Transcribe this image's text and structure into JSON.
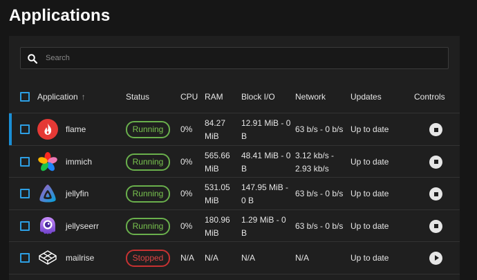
{
  "page_title": "Applications",
  "search": {
    "placeholder": "Search",
    "value": ""
  },
  "columns": {
    "application": "Application",
    "status": "Status",
    "cpu": "CPU",
    "ram": "RAM",
    "block_io": "Block I/O",
    "network": "Network",
    "updates": "Updates",
    "controls": "Controls"
  },
  "sort_indicator": "↑",
  "colors": {
    "accent": "#2d9fe4",
    "running": "#79c34f",
    "stopped": "#e04545",
    "row_highlight": "#1a8fd6"
  },
  "apps": [
    {
      "name": "flame",
      "icon": "flame-icon",
      "status": "Running",
      "cpu": "0%",
      "ram": "84.27 MiB",
      "block_io": "12.91 MiB - 0 B",
      "network": "63 b/s - 0 b/s",
      "updates": "Up to date",
      "control": "stop-icon"
    },
    {
      "name": "immich",
      "icon": "immich-icon",
      "status": "Running",
      "cpu": "0%",
      "ram": "565.66 MiB",
      "block_io": "48.41 MiB - 0 B",
      "network": "3.12 kb/s - 2.93 kb/s",
      "updates": "Up to date",
      "control": "stop-icon"
    },
    {
      "name": "jellyfin",
      "icon": "jellyfin-icon",
      "status": "Running",
      "cpu": "0%",
      "ram": "531.05 MiB",
      "block_io": "147.95 MiB - 0 B",
      "network": "63 b/s - 0 b/s",
      "updates": "Up to date",
      "control": "stop-icon"
    },
    {
      "name": "jellyseerr",
      "icon": "jellyseerr-icon",
      "status": "Running",
      "cpu": "0%",
      "ram": "180.96 MiB",
      "block_io": "1.29 MiB - 0 B",
      "network": "63 b/s - 0 b/s",
      "updates": "Up to date",
      "control": "stop-icon"
    },
    {
      "name": "mailrise",
      "icon": "mailrise-icon",
      "status": "Stopped",
      "cpu": "N/A",
      "ram": "N/A",
      "block_io": "N/A",
      "network": "N/A",
      "updates": "Up to date",
      "control": "play-icon"
    }
  ]
}
